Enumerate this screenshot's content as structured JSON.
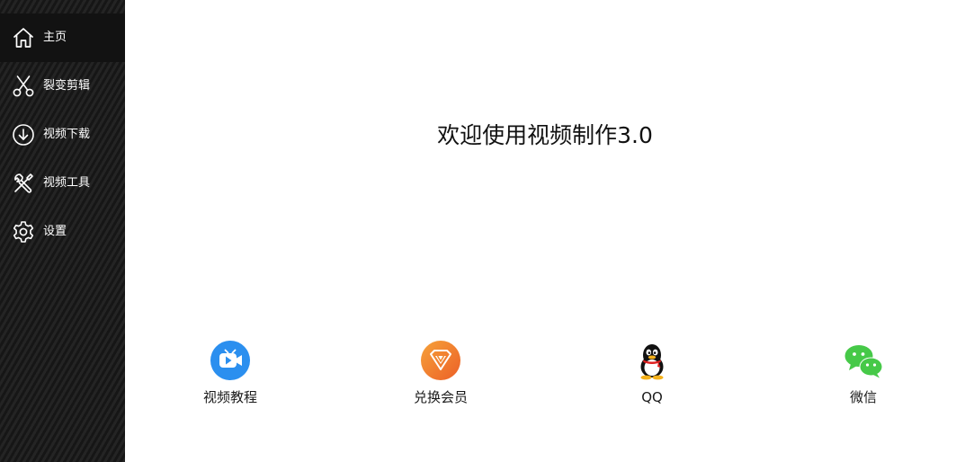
{
  "sidebar": {
    "active_index": 0,
    "items": [
      {
        "label": "主页",
        "icon": "home-icon"
      },
      {
        "label": "裂变剪辑",
        "icon": "scissors-icon"
      },
      {
        "label": "视频下载",
        "icon": "download-icon"
      },
      {
        "label": "视频工具",
        "icon": "tools-icon"
      },
      {
        "label": "设置",
        "icon": "gear-icon"
      }
    ],
    "colors": {
      "background": "#1c1c1c",
      "active_background": "#121212",
      "text": "#ffffff"
    }
  },
  "main": {
    "welcome_text": "欢迎使用视频制作3.0",
    "links": [
      {
        "label": "视频教程",
        "icon": "video-camera-icon",
        "color": "#2b8fef"
      },
      {
        "label": "兑换会员",
        "icon": "vip-diamond-icon",
        "color": "#f3822f"
      },
      {
        "label": "QQ",
        "icon": "qq-penguin-icon",
        "color": "#111111"
      },
      {
        "label": "微信",
        "icon": "wechat-icon",
        "color": "#46c948"
      }
    ]
  }
}
